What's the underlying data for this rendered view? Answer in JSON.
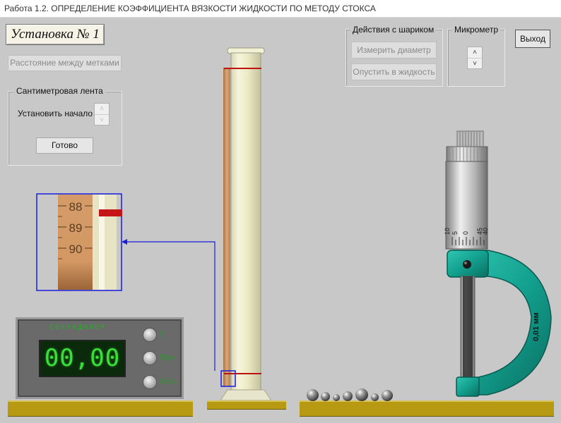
{
  "window": {
    "title": "Работа 1.2. ОПРЕДЕЛЕНИЕ КОЭФФИЦИЕНТА ВЯЗКОСТИ ЖИДКОСТИ ПО МЕТОДУ СТОКСА"
  },
  "install_title": "Установка № 1",
  "buttons": {
    "distance": "Расстояние между метками",
    "done": "Готово",
    "exit": "Выход",
    "measure_diameter": "Измерить диаметр",
    "drop_ball": "Опустить в жидкость"
  },
  "tape_group": {
    "label": "Сантиметровая лента",
    "set_start": "Установить начало"
  },
  "ball_group": {
    "label": "Действия с шариком"
  },
  "micrometer_group": {
    "label": "Микрометр"
  },
  "spin_up": "˄",
  "spin_down": "˅",
  "zoom": {
    "ticks": [
      "88",
      "89",
      "90"
    ]
  },
  "stopwatch": {
    "title": "СЕКУНДОМЕР",
    "display": "00,00",
    "controls": [
      "0",
      "Пуск",
      "Сеть"
    ]
  },
  "micrometer": {
    "scale_label": "0,01 мм",
    "thimble_ticks": [
      "10",
      "5",
      "0",
      "45",
      "40"
    ]
  },
  "colors": {
    "background": "#c8c8c8",
    "shelf": "#b79a12",
    "display_green": "#39e039",
    "frame_teal": "#13a08e",
    "zoom_frame": "#1a1adc",
    "marker_red": "#c01010"
  }
}
